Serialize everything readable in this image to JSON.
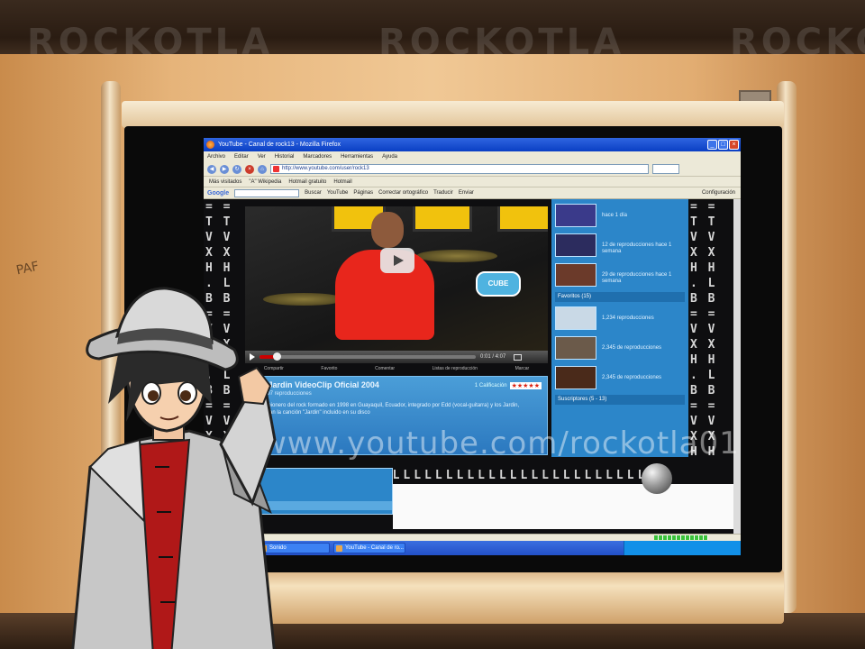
{
  "watermark": "ROCKOTLA",
  "wall_note": "PAF",
  "browser": {
    "window_title": "YouTube - Canal de rock13 - Mozilla Firefox",
    "menu": [
      "Archivo",
      "Editar",
      "Ver",
      "Historial",
      "Marcadores",
      "Herramientas",
      "Ayuda"
    ],
    "url": "http://www.youtube.com/user/rock13",
    "bookmarks": [
      "Más visitados",
      "\"A\" Wikipedia",
      "Hotmail gratuito",
      "Hotmail"
    ],
    "google_bar": {
      "logo": "Google",
      "search_label": "Buscar",
      "items": [
        "YouTube",
        "Páginas",
        "Correctar ortográfico",
        "Traducir",
        "Enviar"
      ],
      "config_label": "Configuración"
    },
    "status_bar": "",
    "taskbar": {
      "items": [
        "Sonido",
        "YouTube - Canal de ro..."
      ],
      "tray_time": ""
    }
  },
  "video": {
    "sticker": "CUBE",
    "progress": 0.08,
    "time": "0:01 / 4:07",
    "tabs": [
      "Compartir",
      "Favorito",
      "Comentar",
      "Listas de reproducción",
      "Marcar"
    ],
    "title": "Los Jardin VideoClip Oficial 2004",
    "rating_label": "1 Calificación",
    "stars": "★★★★★",
    "views": "197 reproducciones",
    "description": "Grupo pionero del rock formado en 1998 en Guayaquil, Ecuador, integrado por Edd (vocal-guitarra) y los Jardin, presentan la canción \"Jardin\" incluido en su disco"
  },
  "sidebar": {
    "items_top": [
      {
        "text": "hace 1 día",
        "color": "#3a3a8a"
      },
      {
        "text": "12 de reproducciones hace 1 semana",
        "color": "#2c2c5e"
      },
      {
        "text": "29 de reproducciones hace 1 semana",
        "color": "#6b3a2a"
      }
    ],
    "header_1": "Favoritos (15)",
    "items_mid": [
      {
        "text": "1,234 reproducciones",
        "color": "#c9d9e6"
      },
      {
        "text": "2,345 de reproducciones",
        "color": "#6b5a4a"
      },
      {
        "text": "2,345 de reproducciones",
        "color": "#4a2a1a"
      }
    ],
    "header_2": "Suscriptores (5 - 13)"
  },
  "overlay_url": "www.youtube.com/rockotla01",
  "colors": {
    "youtube_panel": "#2c86c9",
    "xp_title": "#0a3fc4",
    "wall": "#f0c895"
  }
}
